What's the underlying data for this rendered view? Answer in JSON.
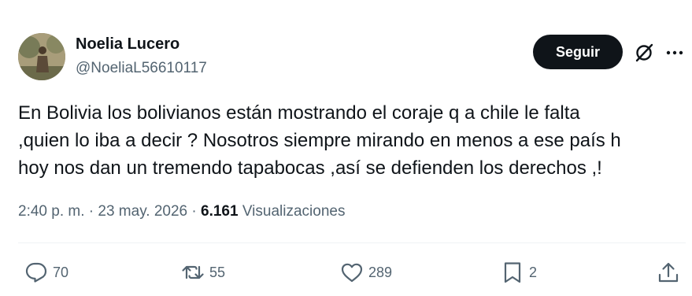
{
  "author": {
    "name": "Noelia Lucero",
    "handle": "@NoeliaL56610117"
  },
  "header": {
    "follow_label": "Seguir"
  },
  "tweet": {
    "lines": [
      "En Bolivia los bolivianos están mostrando el coraje q a chile le falta",
      ",quien lo iba a decir ? Nosotros siempre mirando en menos a ese país h",
      "hoy nos dan un tremendo tapabocas ,así se defienden los derechos ,!"
    ],
    "time": "2:40 p. m.",
    "separator": "·",
    "date": "23 may. 2026",
    "views_count": "6.161",
    "views_label": "Visualizaciones"
  },
  "actions": {
    "replies": "70",
    "retweets": "55",
    "likes": "289",
    "bookmarks": "2"
  },
  "icons": {
    "grok": "grok-icon",
    "more": "more-icon",
    "reply": "reply-icon",
    "retweet": "retweet-icon",
    "like": "heart-icon",
    "bookmark": "bookmark-icon",
    "share": "share-icon"
  },
  "colors": {
    "text": "#0f1419",
    "secondary": "#536471",
    "button_bg": "#0f1419",
    "divider": "#eff3f4"
  }
}
